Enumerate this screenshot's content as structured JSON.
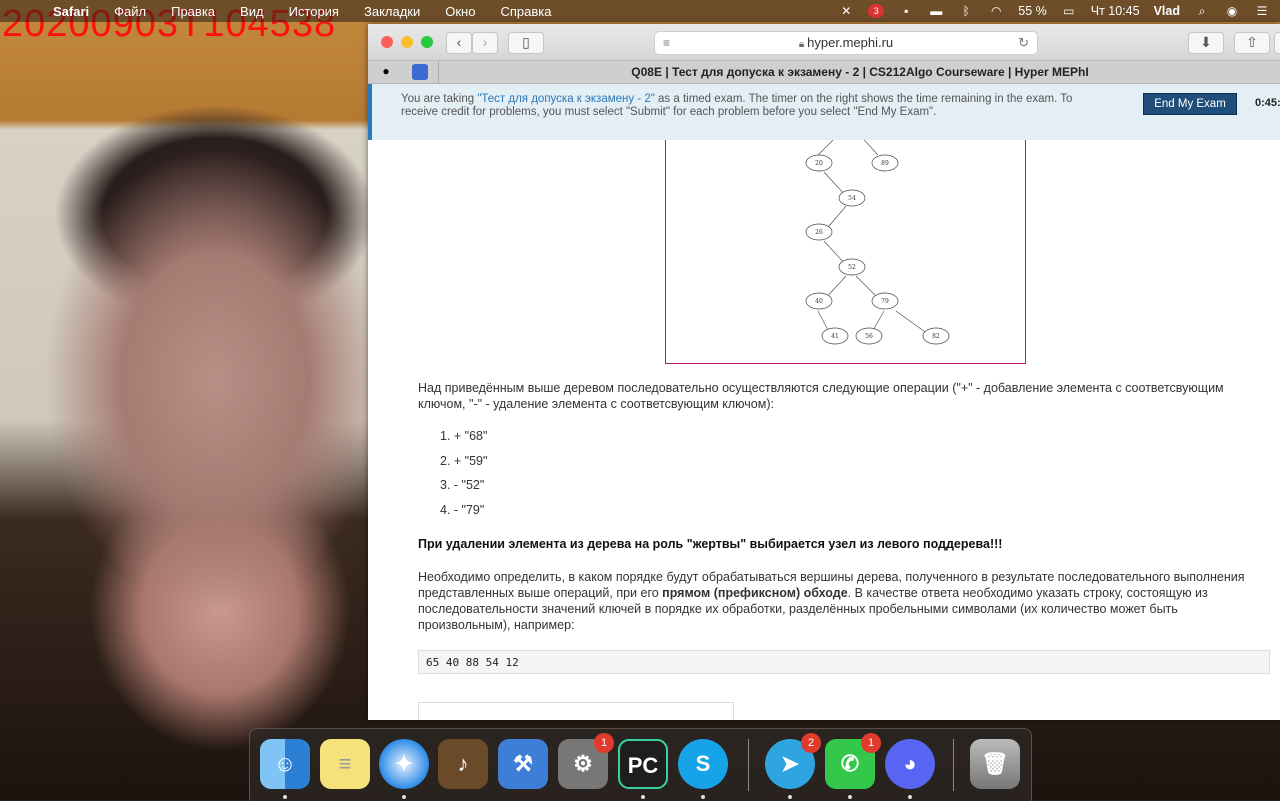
{
  "overlay": {
    "timestamp": "20200903T104538"
  },
  "menubar": {
    "app_name": "Safari",
    "items": [
      "Файл",
      "Правка",
      "Вид",
      "История",
      "Закладки",
      "Окно",
      "Справка"
    ],
    "battery": "55 %",
    "clock": "Чт 10:45",
    "user": "Vlad",
    "notification_badge": "3"
  },
  "browser": {
    "address": "hyper.mephi.ru",
    "tab_title": "Q08E | Тест для допуска к экзамену - 2 | CS212Algo Courseware | Hyper MEPhI"
  },
  "exam_banner": {
    "text_before": "You are taking ",
    "exam_link": "\"Тест для допуска к экзамену - 2\"",
    "text_after": " as a timed exam. The timer on the right shows the time remaining in the exam. To receive credit for problems, you must select \"Submit\" for each problem before you select \"End My Exam\".",
    "end_button": "End My Exam",
    "timer": "0:45:"
  },
  "tree": {
    "nodes": [
      "20",
      "89",
      "54",
      "26",
      "52",
      "40",
      "79",
      "41",
      "56",
      "82"
    ]
  },
  "question": {
    "intro": "Над приведённым выше деревом последовательно осуществляются следующие операции (\"+\" - добавление элемента с соответсвующим ключом, \"-\" - удаление элемента с соответсвующим ключом):",
    "operations": [
      "1.  + \"68\"",
      "2.  + \"59\"",
      "3.  - \"52\"",
      "4.  - \"79\""
    ],
    "warning": "При удалении элемента из дерева на роль \"жертвы\" выбирается узел из левого поддерева!!!",
    "instr_1": "Необходимо определить, в каком порядке будут обрабатываться вершины дерева, полученного в результате последовательного выполнения представленных выше операций, при его ",
    "instr_bold": "прямом (префиксном) обходе",
    "instr_2": ". В качестве ответа необходимо указать строку, состоящую из последовательности значений ключей в порядке их обработки, разделённых пробельными символами (их количество может быть произвольным), например:",
    "example": "65 40 88 54 12"
  },
  "dock": {
    "apps": [
      {
        "name": "Finder",
        "color": "#3a8ee8"
      },
      {
        "name": "Notes",
        "color": "#f5e27a"
      },
      {
        "name": "Safari",
        "color": "#2d8ae6"
      },
      {
        "name": "GarageBand",
        "color": "#6b4a2a"
      },
      {
        "name": "Xcode",
        "color": "#3d7fd6"
      },
      {
        "name": "System Preferences",
        "color": "#777777",
        "badge": "1"
      },
      {
        "name": "PyCharm",
        "color": "#1e1e1e"
      },
      {
        "name": "Skype",
        "color": "#17a3e8"
      },
      {
        "name": "Telegram",
        "color": "#2ea5e0",
        "badge": "2"
      },
      {
        "name": "FaceTime",
        "color": "#34c84a",
        "badge": "1"
      },
      {
        "name": "Discord",
        "color": "#5865f2"
      },
      {
        "name": "Trash",
        "color": "#8a8a8a"
      }
    ]
  }
}
